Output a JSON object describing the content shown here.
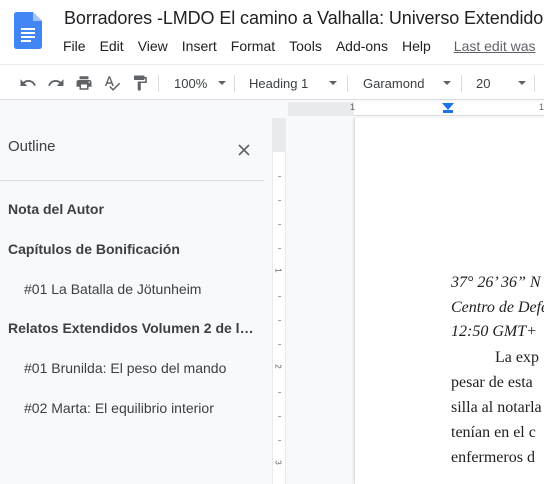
{
  "header": {
    "title": "Borradores -LMDO El camino a Valhalla: Universo Extendido",
    "menu": [
      "File",
      "Edit",
      "View",
      "Insert",
      "Format",
      "Tools",
      "Add-ons",
      "Help"
    ],
    "last_edit": "Last edit was"
  },
  "toolbar": {
    "zoom": "100%",
    "style": "Heading 1",
    "font": "Garamond",
    "size": "20"
  },
  "ruler": {
    "numbers": [
      "1",
      "1"
    ]
  },
  "vruler": {
    "numbers": [
      "1",
      "2",
      "3"
    ]
  },
  "outline": {
    "title": "Outline",
    "items": [
      {
        "label": "Nota del Autor",
        "level": 1
      },
      {
        "label": "Capítulos de Bonificación",
        "level": 1
      },
      {
        "label": "#01 La Batalla de Jötunheim",
        "level": 2
      },
      {
        "label": "Relatos Extendidos Volumen 2 de la O...",
        "level": 1
      },
      {
        "label": "#01 Brunilda: El peso del mando",
        "level": 2
      },
      {
        "label": "#02 Marta: El equilibrio interior",
        "level": 2
      }
    ]
  },
  "document": {
    "lines": [
      "37° 26’ 36” N",
      "Centro de Defe",
      "12:50 GMT+",
      "La exp",
      "pesar de esta",
      "silla al notarla",
      "tenían en el c",
      "enfermeros d"
    ]
  },
  "colors": {
    "accent": "#1a73e8",
    "doc_icon": "#4285f4"
  }
}
